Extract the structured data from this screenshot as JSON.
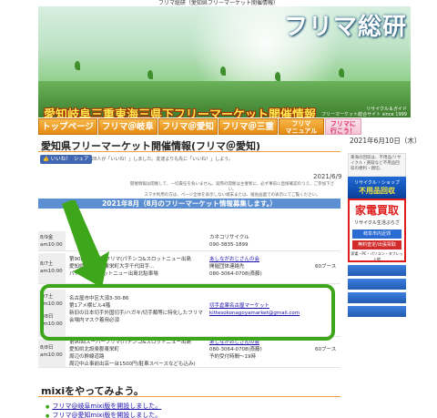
{
  "browser_caption": "フリマ総研（愛知県フリーマーケット開催情報）",
  "header": {
    "brand": "フリマ総研",
    "headline": "愛知岐阜三重東海三県下フリーマーケット開催情報",
    "side_text_1": "リサイクル＆ガイド",
    "side_text_2": "フリーマーケット総合サイト since 1999"
  },
  "nav": {
    "tabs": [
      {
        "label": "トップページ"
      },
      {
        "label": "フリマ＠岐阜"
      },
      {
        "label": "フリマ＠愛知"
      },
      {
        "label": "フリマ＠三重"
      },
      {
        "label": "フリマ\nマニュアル"
      },
      {
        "label": "フリマに\n行こう！"
      }
    ]
  },
  "page": {
    "title": "愛知県フリーマーケット開催情報(フリマ＠愛知)",
    "current_date": "2021年6月10日（木）",
    "like_label": "いいね！",
    "share_label": "シェア",
    "fb_text": "28人が「いいね！」しました。友達よりも先に「いいね！」しよう。",
    "post_date": "2021/6/9",
    "notice_1": "開催情報は開催して、一切責任を負いません。実際の開催は主催者に、必ず事前に直接確認のうえ、ご参加下さい。",
    "notice_2": "スマホ利用の方は、ページ全体を表示しない端末または、縦長画面での表示にてご覧ください。"
  },
  "table": {
    "header": "2021年8月（8月のフリーマーケット情報募集します。）",
    "rows": [
      {
        "date": "8/9金",
        "time": "am10:00",
        "place": "",
        "contact": "カネコリサイクル",
        "phone": "090-3835-1899",
        "booths": ""
      },
      {
        "date": "8/7土",
        "time": "am10:00",
        "place_1": "第90回スーパーフリマ(パチンコ&スロットニュー出島",
        "place_2": "愛知県北設楽郡東栄町大字千代田字...",
        "place_3": "パチンコ&スロットニュー出島北駐車場",
        "contact": "あしながおじさんの会",
        "phone_1": "開催団体連絡先",
        "phone_2": "080-3064-0708(斎藤)",
        "booths": "60ブース"
      },
      {
        "date": "8/7土",
        "time": "am10:00",
        "date2": "8/8日",
        "time2": "am10:00",
        "place_1": "名古屋市中区大須3-30-86",
        "place_2": "第1アメ横ビル4階",
        "place_3": "新旧の日本切手外国切手/ハガキ/切手類等に特化したフリマ",
        "place_4": "会場内マスク着用必須",
        "contact": "切手倉庫名古屋マーケット",
        "email": "kittesokonagoyamarket@gmail.com",
        "booths": ""
      },
      {
        "date": "8/8日",
        "time": "am10:00",
        "place_1": "第90回スーパーフリマ(パチンコ&スロットニュー出島",
        "place_2": "愛知県北設楽郡東栄町",
        "place_3": "周辺の幹線道路",
        "place_4": "周辺中止事前出店一台1500円(駐車スペースなども込み)",
        "contact": "あしながおじさんの会",
        "phone_1": "080-3064-0708(斎藤)",
        "phone_2": "予約受付時間～19時",
        "booths": "60ブース"
      }
    ]
  },
  "sidebar": {
    "top_text": "東海の回収は、不用品/リサイクル・買取など不用品回収の便利・親切。",
    "blue_a": "リサイクル・ショップ",
    "blue_b": "不用品回収",
    "blue_c": "東海エリア",
    "ad_big": "家電買取",
    "ad_small": "リサイクル生活ぷらざ",
    "ad_bar": "岐阜市内近郊",
    "ad_bar2": "無料査定/出張買取",
    "ad_foot": "家電・PC・パソコン・タブレット他"
  },
  "mixi": {
    "title": "mixiをやってみよう。",
    "items": [
      {
        "label": "フリマ@岐阜mixi版を開設しました。"
      },
      {
        "label": "フリマ@愛知mixi版を開設しました。"
      }
    ]
  }
}
